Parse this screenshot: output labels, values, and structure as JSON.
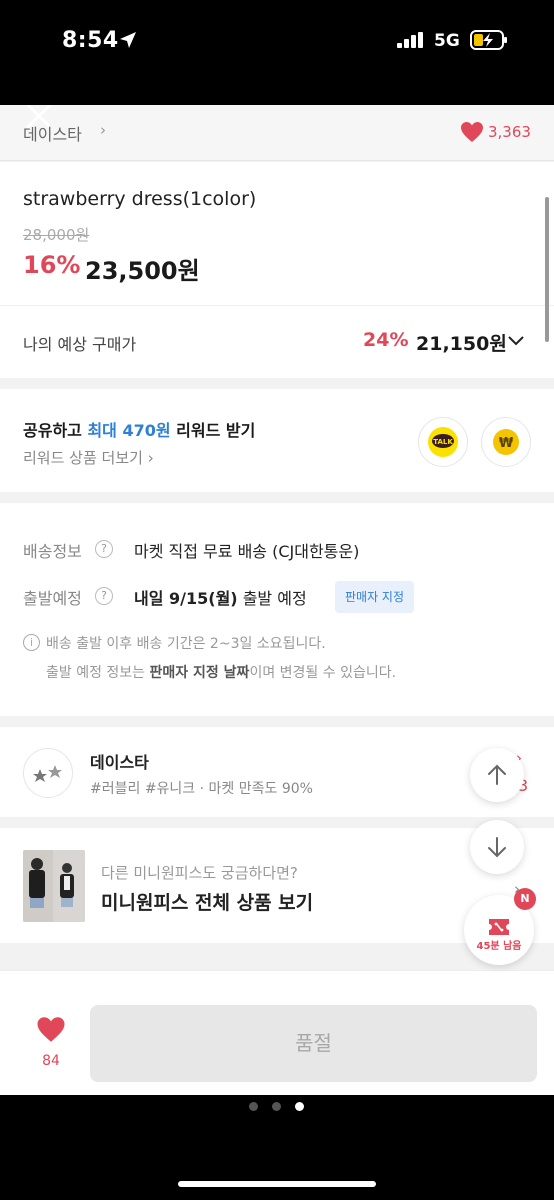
{
  "status_bar": {
    "time": "8:54",
    "network": "5G"
  },
  "store_header": {
    "name": "데이스타",
    "chevron": "›",
    "like_count": "3,363"
  },
  "product": {
    "title": "strawberry dress(1color)",
    "original_price": "28,000원",
    "discount": "16%",
    "price": "23,500원"
  },
  "expected_price": {
    "label": "나의 예상 구매가",
    "discount": "24%",
    "price": "21,150원"
  },
  "share_reward": {
    "title_prefix": "공유하고 ",
    "title_highlight": "최대 470원",
    "title_suffix": " 리워드 받기",
    "more_link": "리워드 상품 더보기 ›",
    "kakao_label": "TALK",
    "pay_symbol": "₩"
  },
  "shipping": {
    "info_label": "배송정보",
    "info_value": "마켓 직접 무료 배송 (CJ대한통운)",
    "departure_label": "출발예정",
    "departure_date": "내일 9/15(월)",
    "departure_suffix": " 출발 예정",
    "seller_badge": "판매자 지정",
    "help_mark": "?",
    "info_mark": "i",
    "notice_line1": "배송 출발 이후 배송 기간은 2~3일 소요됩니다.",
    "notice_line2_prefix": "출발 예정 정보는 ",
    "notice_line2_bold": "판매자 지정 날짜",
    "notice_line2_suffix": "이며 변경될 수 있습니다."
  },
  "store_info": {
    "name": "데이스타",
    "tags": "#러블리 #유니크 · 마켓 만족도 90%",
    "logo_text": "★★",
    "right_mark": "›",
    "right_number": "3"
  },
  "recommendation": {
    "subtitle": "다른 미니원피스도 궁금하다면?",
    "title": "미니원피스 전체 상품 보기",
    "chevron": "›"
  },
  "bottom_bar": {
    "like_count": "84",
    "soldout_label": "품절"
  },
  "coupon": {
    "badge": "N",
    "time_left": "45분 남음"
  },
  "colors": {
    "accent_red": "#e0485a",
    "accent_blue": "#2e7fd6",
    "kakao_yellow": "#fae100"
  }
}
